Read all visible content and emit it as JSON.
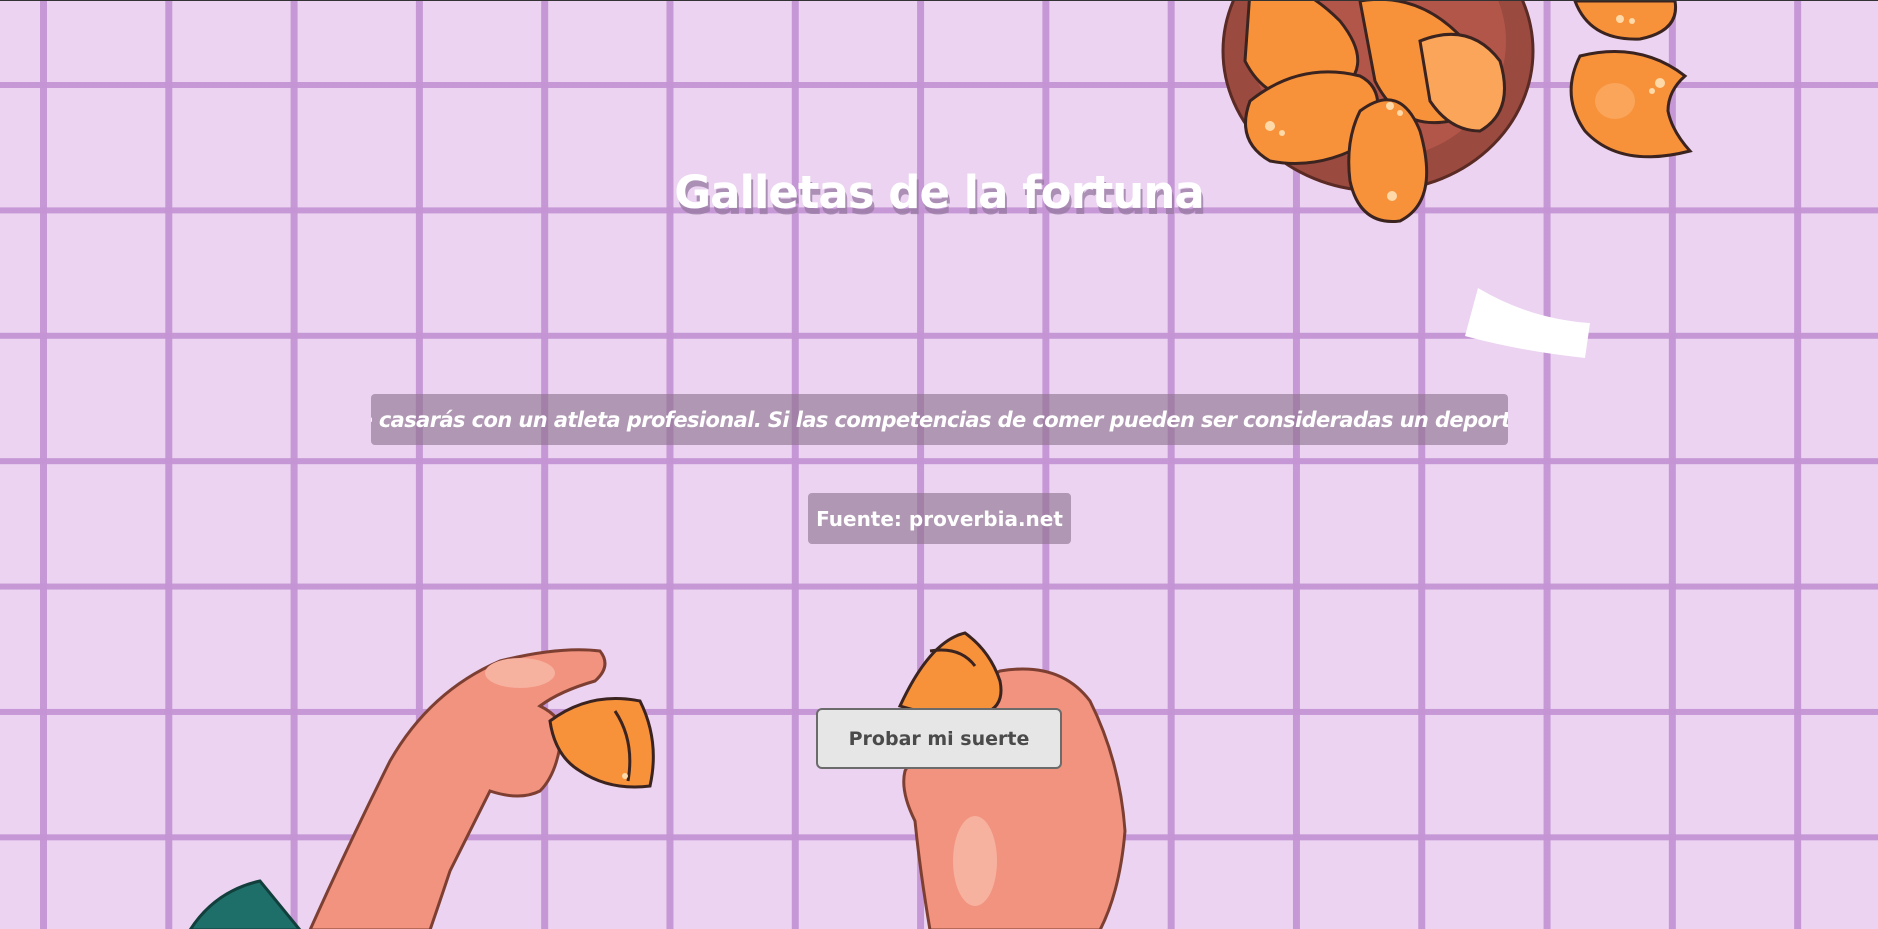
{
  "page": {
    "title": "Galletas de la fortuna",
    "quote": "\"Te casarás con un atleta profesional. Si las competencias de comer pueden ser consideradas un deporte.\"",
    "source": "Fuente: proverbia.net",
    "button_label": "Probar mi suerte"
  },
  "colors": {
    "background": "#ebd3f1",
    "grid_lines": "#c494d4",
    "cookie": "#f7923a",
    "bowl": "#9a4a3f",
    "skin": "#f1937e",
    "sleeve": "#1e6e6a"
  },
  "illustrations": [
    "fortune-cookie-bowl",
    "fortune-cookie",
    "paper-fortune-slip",
    "left-hand-holding-cookie",
    "right-hand-holding-cookie"
  ]
}
